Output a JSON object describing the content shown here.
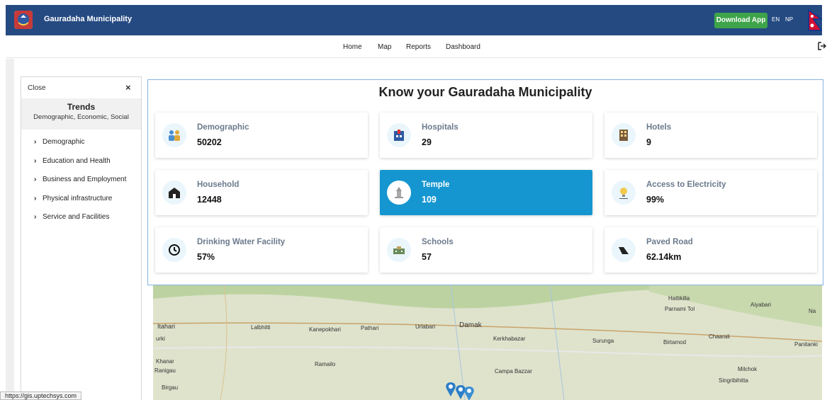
{
  "header": {
    "title": "Gauradaha Municipality",
    "download_label": "Download App",
    "lang_en": "EN",
    "lang_np": "NP"
  },
  "nav": {
    "items": [
      "Home",
      "Map",
      "Reports",
      "Dashboard"
    ]
  },
  "sidebar": {
    "close_label": "Close",
    "close_x": "×",
    "title": "Trends",
    "subtitle": "Demographic, Economic, Social",
    "items": [
      "Demographic",
      "Education and Health",
      "Business and Employment",
      "Physical infrastructure",
      "Service and Facilities"
    ]
  },
  "panel": {
    "title": "Know your Gauradaha Municipality",
    "cards": [
      {
        "label": "Demographic",
        "value": "50202",
        "icon": "people-icon"
      },
      {
        "label": "Hospitals",
        "value": "29",
        "icon": "hospital-icon"
      },
      {
        "label": "Hotels",
        "value": "9",
        "icon": "hotel-icon"
      },
      {
        "label": "Household",
        "value": "12448",
        "icon": "house-icon"
      },
      {
        "label": "Temple",
        "value": "109",
        "icon": "temple-icon"
      },
      {
        "label": "Access to Electricity",
        "value": "99%",
        "icon": "bulb-icon"
      },
      {
        "label": "Drinking Water Facility",
        "value": "57%",
        "icon": "water-icon"
      },
      {
        "label": "Schools",
        "value": "57",
        "icon": "school-icon"
      },
      {
        "label": "Paved Road",
        "value": "62.14km",
        "icon": "road-icon"
      }
    ],
    "active_card": "Temple"
  },
  "map": {
    "labels": [
      "Itahari",
      "Lalbhitti",
      "Kanepokhari",
      "Pathari",
      "Urlabari",
      "Damak",
      "Kerkhabazar",
      "Surunga",
      "Birtamod",
      "Chaarali",
      "Panitanki",
      "Hattikilla",
      "Parnami Tol",
      "Aiyabari",
      "Na",
      "Khanar",
      "Ranigau",
      "Ramailo",
      "Campa Bazzar",
      "Milchok",
      "Singribihitta",
      "Birgau",
      "urki"
    ]
  },
  "status_url": "https://gis.uptechsys.com",
  "colors": {
    "header_bg": "#254a82",
    "download_bg": "#3ea44a",
    "active_card_bg": "#1596d0",
    "panel_border": "#86b5e0"
  }
}
